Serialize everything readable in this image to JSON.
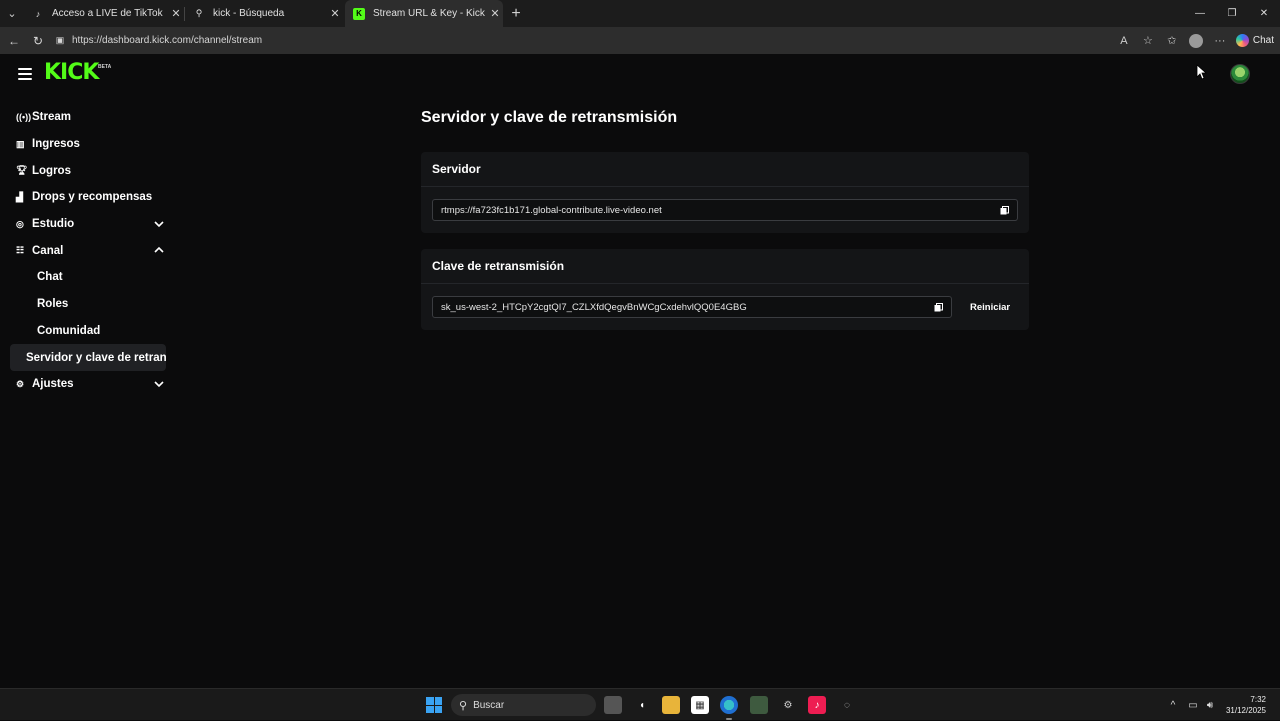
{
  "browser": {
    "tabs": [
      {
        "label": "Acceso a LIVE de TikTok",
        "favicon": "tiktok-icon",
        "active": false
      },
      {
        "label": "kick - Búsqueda",
        "favicon": "search-icon",
        "active": false
      },
      {
        "label": "Stream URL & Key - Kick Dashboard",
        "favicon": "kick-icon",
        "active": true
      }
    ],
    "url": "https://dashboard.kick.com/channel/stream",
    "copilot_label": "Chat"
  },
  "header": {
    "logo_text": "KICK",
    "logo_badge": "BETA",
    "brand_color": "#53fc18"
  },
  "sidebar": {
    "items": [
      {
        "label": "Stream",
        "icon": "stream-icon"
      },
      {
        "label": "Ingresos",
        "icon": "chart-icon"
      },
      {
        "label": "Logros",
        "icon": "trophy-icon"
      },
      {
        "label": "Drops y recompensas",
        "icon": "drops-icon"
      },
      {
        "label": "Estudio",
        "icon": "studio-icon",
        "expanded": false
      },
      {
        "label": "Canal",
        "icon": "channel-icon",
        "expanded": true
      },
      {
        "label": "Ajustes",
        "icon": "gear-icon",
        "expanded": false
      }
    ],
    "canal_sub": [
      {
        "label": "Chat"
      },
      {
        "label": "Roles"
      },
      {
        "label": "Comunidad"
      },
      {
        "label": "Servidor y clave de retransmisión",
        "active": true
      }
    ]
  },
  "main": {
    "title": "Servidor y clave de retransmisión",
    "server_card": {
      "heading": "Servidor",
      "value": "rtmps://fa723fc1b171.global-contribute.live-video.net"
    },
    "key_card": {
      "heading": "Clave de retransmisión",
      "value": "sk_us-west-2_HTCpY2cgtQI7_CZLXfdQegvBnWCgCxdehvlQQ0E4GBG",
      "reset_label": "Reiniciar"
    }
  },
  "taskbar": {
    "search_placeholder": "Buscar",
    "time": "7:32",
    "date": "31/12/2025"
  }
}
